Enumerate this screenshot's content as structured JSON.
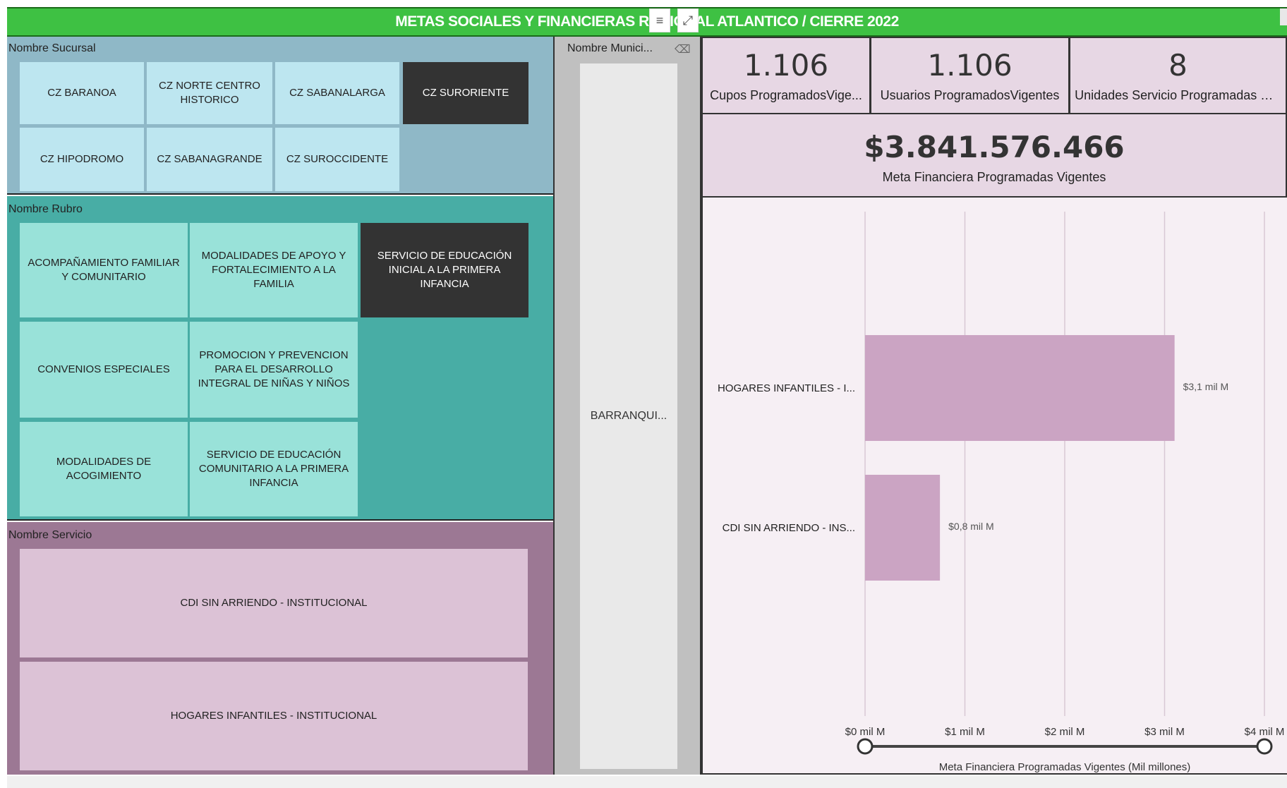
{
  "header": {
    "title": "METAS SOCIALES Y FINANCIERAS REGIONAL ATLANTICO / CIERRE 2022",
    "filter_icon": "filter-icon",
    "focus_icon": "focus-mode-icon"
  },
  "sucursal": {
    "label": "Nombre Sucursal",
    "items": [
      {
        "label": "CZ BARANOA",
        "selected": false
      },
      {
        "label": "CZ NORTE CENTRO HISTORICO",
        "selected": false
      },
      {
        "label": "CZ SABANALARGA",
        "selected": false
      },
      {
        "label": "CZ SURORIENTE",
        "selected": true
      },
      {
        "label": "CZ HIPODROMO",
        "selected": false
      },
      {
        "label": "CZ SABANAGRANDE",
        "selected": false
      },
      {
        "label": "CZ SUROCCIDENTE",
        "selected": false
      }
    ]
  },
  "rubro": {
    "label": "Nombre Rubro",
    "items": [
      {
        "label": "ACOMPAÑAMIENTO FAMILIAR Y COMUNITARIO",
        "selected": false
      },
      {
        "label": "MODALIDADES DE APOYO Y FORTALECIMIENTO A LA FAMILIA",
        "selected": false
      },
      {
        "label": "SERVICIO DE EDUCACIÓN INICIAL A LA PRIMERA INFANCIA",
        "selected": true
      },
      {
        "label": "CONVENIOS ESPECIALES",
        "selected": false
      },
      {
        "label": "PROMOCION Y PREVENCION PARA EL DESARROLLO INTEGRAL DE NIÑAS Y NIÑOS",
        "selected": false
      },
      {
        "label": "MODALIDADES DE ACOGIMIENTO",
        "selected": false
      },
      {
        "label": "SERVICIO DE EDUCACIÓN COMUNITARIO A LA PRIMERA INFANCIA",
        "selected": false
      }
    ]
  },
  "servicio": {
    "label": "Nombre Servicio",
    "items": [
      {
        "label": "CDI SIN ARRIENDO - INSTITUCIONAL"
      },
      {
        "label": "HOGARES INFANTILES - INSTITUCIONAL"
      }
    ]
  },
  "municipio": {
    "label": "Nombre Munici...",
    "eraser_icon": "eraser-icon",
    "value": "BARRANQUI..."
  },
  "kpis": [
    {
      "value": "1.106",
      "label": "Cupos ProgramadosVige..."
    },
    {
      "value": "1.106",
      "label": "Usuarios ProgramadosVigentes"
    },
    {
      "value": "8",
      "label": "Unidades Servicio Programadas Vi..."
    }
  ],
  "meta_financiera": {
    "value": "$3.841.576.466",
    "label": "Meta Financiera Programadas Vigentes"
  },
  "colors": {
    "header_green": "#3ec143",
    "bar": "#cba4c3",
    "selected_tile": "#333333"
  },
  "chart_data": {
    "type": "bar",
    "orientation": "horizontal",
    "categories": [
      "HOGARES INFANTILES - I...",
      "CDI SIN ARRIENDO - INS..."
    ],
    "values": [
      3.1,
      0.75
    ],
    "data_labels": [
      "$3,1 mil M",
      "$0,8 mil M"
    ],
    "xticks": [
      "$0 mil M",
      "$1 mil M",
      "$2 mil M",
      "$3 mil M",
      "$4 mil M"
    ],
    "xlim": [
      0,
      4
    ],
    "xlabel": "Meta Financiera Programadas Vigentes (Mil millones)",
    "grid": true
  }
}
